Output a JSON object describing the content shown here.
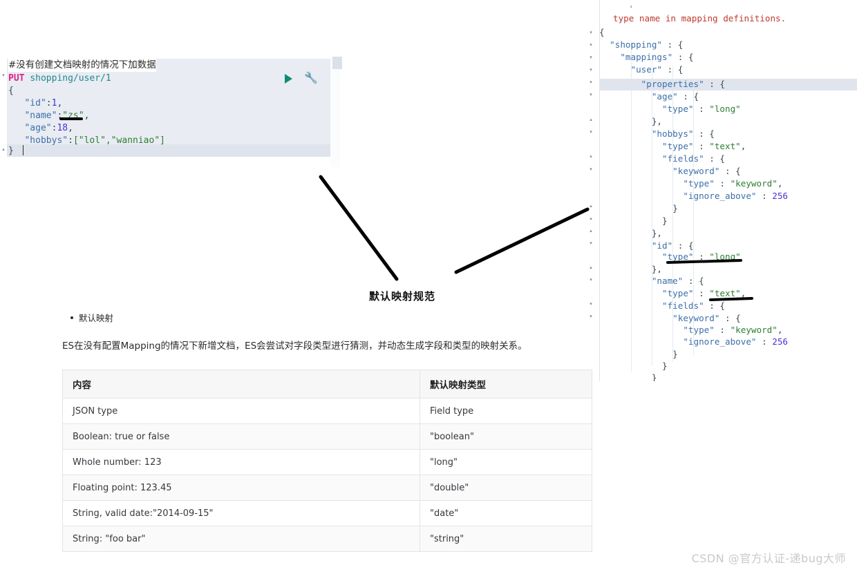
{
  "console_request": {
    "comment_line": "#没有创建文档映射的情况下加数据",
    "method": "PUT",
    "path": "shopping/user/1",
    "body_lines": [
      "{",
      "   \"id\":1,",
      "   \"name\":\"zs\",",
      "   \"age\":18,",
      "   \"hobbys\":[\"lol\",\"wanniao\"]",
      "}"
    ],
    "body_tokens": {
      "open_brace": "{",
      "id_key": "\"id\"",
      "id_val": "1",
      "name_key": "\"name\"",
      "name_val": "\"zs\"",
      "age_key": "\"age\"",
      "age_val": "18",
      "hobbys_key": "\"hobbys\"",
      "hobbys_val": "[\"lol\",\"wanniao\"]",
      "close_brace": "}",
      "colon": ":",
      "comma": ","
    },
    "actions": {
      "play_label": "send-request",
      "wrench_label": "wrench"
    }
  },
  "console_response": {
    "clipped_top_line": "_ ', _",
    "deprecation_line": "type name in mapping definitions.",
    "lines": [
      "{",
      "  \"shopping\" : {",
      "    \"mappings\" : {",
      "      \"user\" : {",
      "        \"properties\" : {",
      "          \"age\" : {",
      "            \"type\" : \"long\"",
      "          },",
      "          \"hobbys\" : {",
      "            \"type\" : \"text\",",
      "            \"fields\" : {",
      "              \"keyword\" : {",
      "                \"type\" : \"keyword\",",
      "                \"ignore_above\" : 256",
      "              }",
      "            }",
      "          },",
      "          \"id\" : {",
      "            \"type\" : \"long\"",
      "          },",
      "          \"name\" : {",
      "            \"type\" : \"text\",",
      "            \"fields\" : {",
      "              \"keyword\" : {",
      "                \"type\" : \"keyword\",",
      "                \"ignore_above\" : 256",
      "              }",
      "            }",
      "          }",
      "        }",
      "      }",
      "    }",
      "  }",
      "}"
    ],
    "highlighted_line": "\"properties\" : {",
    "values": {
      "ignore_above": "256",
      "type_long": "\"long\"",
      "type_text": "\"text\"",
      "type_keyword": "\"keyword\""
    }
  },
  "annotation": {
    "caption": "默认映射规范"
  },
  "article": {
    "bullet": "默认映射",
    "paragraph": "ES在没有配置Mapping的情况下新增文档，ES会尝试对字段类型进行猜测，并动态生成字段和类型的映射关系。",
    "table": {
      "headers": [
        "内容",
        "默认映射类型"
      ],
      "rows": [
        [
          "JSON type",
          "Field type"
        ],
        [
          "Boolean: true or false",
          "\"boolean\""
        ],
        [
          "Whole number: 123",
          "\"long\""
        ],
        [
          "Floating point: 123.45",
          "\"double\""
        ],
        [
          "String, valid date:\"2014-09-15\"",
          "\"date\""
        ],
        [
          "String: \"foo bar\"",
          "\"string\""
        ]
      ]
    }
  },
  "watermark": {
    "text": "CSDN @官方认证-递bug大师"
  },
  "colors": {
    "editor_background": "#e9ecf3",
    "highlight_row": "#dfe3ec",
    "method_keyword": "#e0218a",
    "string_value": "#2e7d32",
    "json_key": "#3d6fa8",
    "number_value": "#4b2fd6",
    "error_text": "#c0392b",
    "play_icon": "#108a77",
    "table_header_background": "#f7f7f7",
    "watermark": "#c9c9c9"
  }
}
